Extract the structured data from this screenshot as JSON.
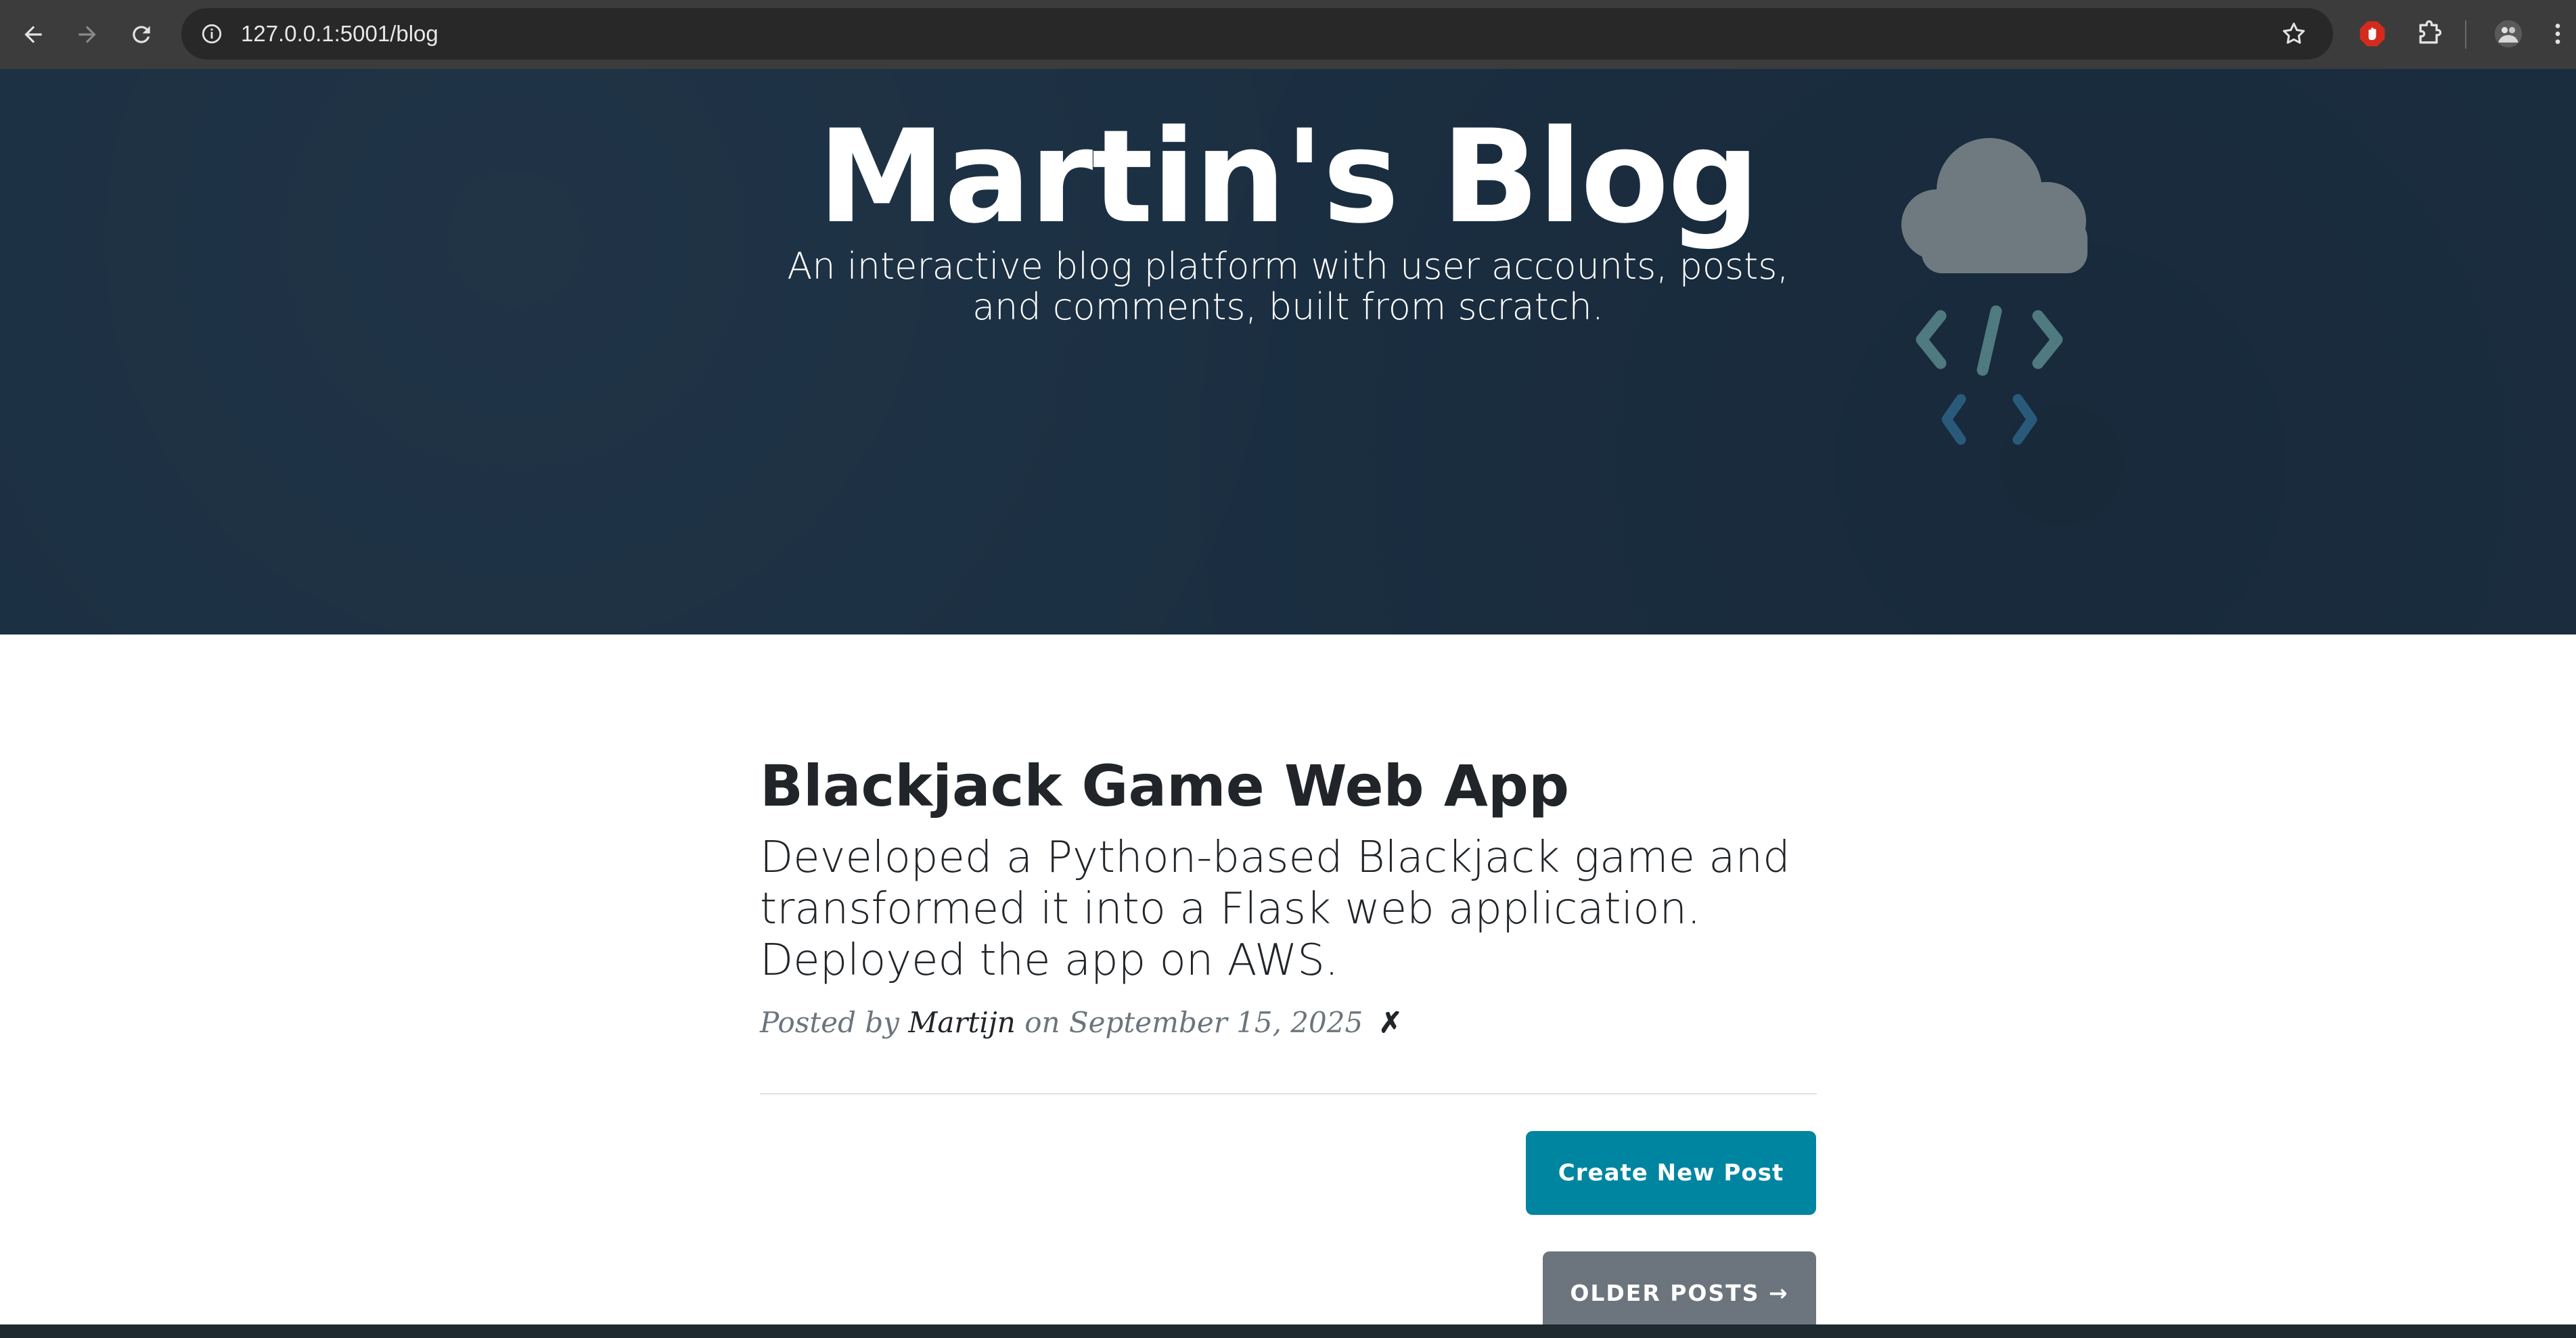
{
  "browser": {
    "url": "127.0.0.1:5001/blog",
    "icons": [
      "back-arrow-icon",
      "forward-arrow-icon",
      "reload-icon",
      "site-info-icon",
      "bookmark-star-icon",
      "adblock-extension-icon",
      "extensions-puzzle-icon",
      "profile-avatar-icon",
      "kebab-menu-icon"
    ]
  },
  "hero": {
    "title": "Martin's Blog",
    "subtitle": "An interactive blog platform with user accounts, posts, and comments, built from scratch.",
    "logo_icon": "cloud-code-logo-icon"
  },
  "post": {
    "title": "Blackjack Game Web App",
    "subtitle": "Developed a Python-based Blackjack game and transformed it into a Flask web application. Deployed the app on AWS.",
    "meta_prefix": "Posted by ",
    "author": "Martijn",
    "meta_date": " on September 15, 2025",
    "delete_glyph": "✗"
  },
  "actions": {
    "create_label": "Create New Post",
    "older_label": "OLDER POSTS →"
  },
  "colors": {
    "hero_bg": "#1b2f42",
    "primary_button": "#0085a1",
    "secondary_button": "#6c757d"
  }
}
